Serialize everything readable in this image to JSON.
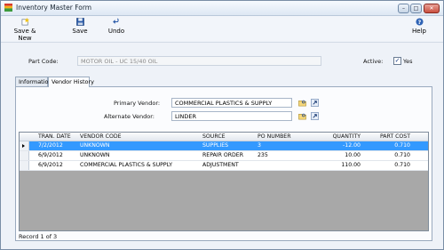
{
  "window": {
    "title": "Inventory Master Form",
    "accent": "#3399ff"
  },
  "toolbar": {
    "save_new": "Save & New",
    "save": "Save",
    "undo": "Undo",
    "help": "Help"
  },
  "form": {
    "part_code_label": "Part Code:",
    "part_code_value": "MOTOR OIL  - UC 15/40 OIL",
    "active_label": "Active:",
    "active_checked": true,
    "active_value_label": "Yes"
  },
  "tabs": [
    "Information",
    "Vendor History"
  ],
  "vendor": {
    "primary_label": "Primary Vendor:",
    "primary_value": "COMMERCIAL PLASTICS & SUPPLY",
    "alternate_label": "Alternate Vendor:",
    "alternate_value": "LINDER"
  },
  "grid": {
    "columns": [
      "TRAN. DATE",
      "VENDOR CODE",
      "SOURCE",
      "PO NUMBER",
      "QUANTITY",
      "PART COST"
    ],
    "rows": [
      {
        "date": "7/2/2012",
        "vendor": "UNKNOWN",
        "source": "SUPPLIES",
        "po": "3",
        "qty": "-12.00",
        "cost": "0.710",
        "selected": true
      },
      {
        "date": "6/9/2012",
        "vendor": "UNKNOWN",
        "source": "REPAIR ORDER",
        "po": "235",
        "qty": "10.00",
        "cost": "0.710",
        "selected": false
      },
      {
        "date": "6/9/2012",
        "vendor": "COMMERCIAL PLASTICS & SUPPLY",
        "source": "ADJUSTMENT",
        "po": "",
        "qty": "110.00",
        "cost": "0.710",
        "selected": false
      }
    ]
  },
  "status": "Record 1 of 3"
}
